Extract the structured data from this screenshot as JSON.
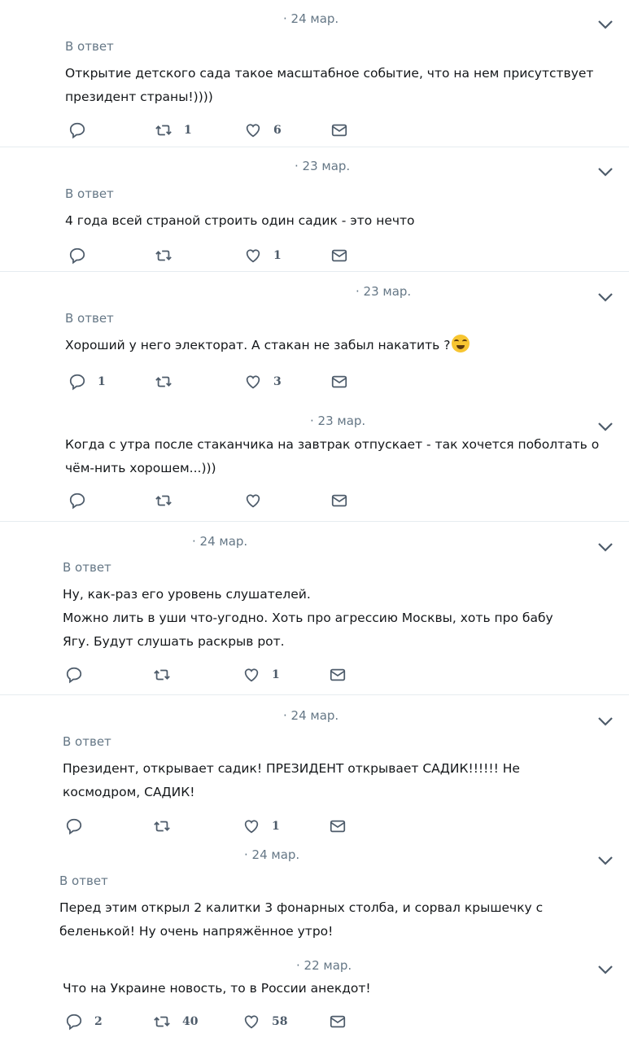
{
  "tweets": [
    {
      "date": "· 24 мар.",
      "reply": "В ответ",
      "lines": [
        "Открытие детского сада такое масштабное событие, что на нем присутствует",
        "президент страны!))))"
      ],
      "counts": {
        "reply": "",
        "retweet": "1",
        "like": "6"
      }
    },
    {
      "date": "· 23 мар.",
      "reply": "В ответ",
      "lines": [
        "4 года всей страной строить один садик - это нечто"
      ],
      "counts": {
        "reply": "",
        "retweet": "",
        "like": "1"
      }
    },
    {
      "date": "· 23 мар.",
      "reply": "В ответ",
      "lines": [
        "Хороший у него электорат. А стакан не забыл накатить ?"
      ],
      "emoji": "face-with-tears-of-joy-icon",
      "counts": {
        "reply": "1",
        "retweet": "",
        "like": "3"
      }
    },
    {
      "date": "· 23 мар.",
      "reply": "",
      "lines": [
        "Когда с утра после стаканчика на завтрак отпускает - так хочется поболтать о",
        "чём-нить хорошем...)))"
      ],
      "counts": {
        "reply": "",
        "retweet": "",
        "like": ""
      }
    },
    {
      "date": "· 24 мар.",
      "reply": "В ответ",
      "lines": [
        "Ну, как-раз его уровень слушателей.",
        "Можно лить в уши что-угодно. Хоть про агрессию Москвы, хоть про бабу",
        "Ягу. Будут слушать раскрыв рот."
      ],
      "counts": {
        "reply": "",
        "retweet": "",
        "like": "1"
      }
    },
    {
      "date": "· 24 мар.",
      "reply": "В ответ",
      "lines": [
        "Президент, открывает садик! ПРЕЗИДЕНТ открывает САДИК!!!!!! Не",
        "космодром, САДИК!"
      ],
      "counts": {
        "reply": "",
        "retweet": "",
        "like": "1"
      }
    },
    {
      "date": "· 24 мар.",
      "reply": "В ответ",
      "lines": [
        "Перед этим открыл 2 калитки 3 фонарных столба, и сорвал крышечку с",
        "беленькой! Ну очень напряжённое утро!"
      ],
      "counts": null
    },
    {
      "date": "· 22 мар.",
      "reply": "",
      "lines": [
        "Что на Украине новость, то в России анекдот!"
      ],
      "counts": {
        "reply": "2",
        "retweet": "40",
        "like": "58"
      }
    }
  ]
}
